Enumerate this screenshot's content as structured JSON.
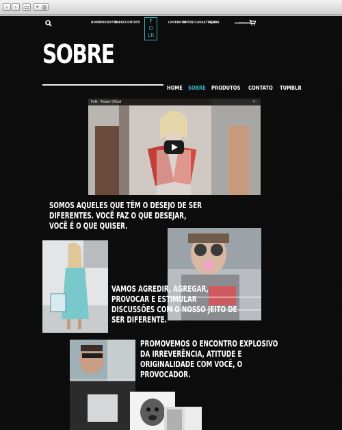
{
  "browser": {
    "back": "‹",
    "forward": "›",
    "reader": "▭",
    "add": "+",
    "globe": "◍"
  },
  "top_nav": {
    "left_links": [
      "HOME",
      "PRODUTOS",
      "SOBRE",
      "CONTATO"
    ],
    "right_links": [
      "LOOKBOOK",
      "ENTRE/CADASTRE-SE",
      "AJUDA"
    ],
    "cart_label": "CARRINHO"
  },
  "logo": {
    "letters": [
      "F",
      "O",
      "L",
      "K"
    ]
  },
  "page_title": "SOBRE",
  "secondary_nav": [
    {
      "label": "HOME",
      "active": false
    },
    {
      "label": "SOBRE",
      "active": true
    },
    {
      "label": "PRODUTOS",
      "active": false
    },
    {
      "label": "CONTATO",
      "active": false
    },
    {
      "label": "TUMBLR",
      "active": false
    }
  ],
  "video": {
    "title": "Folk - Teaser Oficial"
  },
  "copy_blocks": [
    [
      "SOMOS AQUELES QUE TÊM O DESEJO DE SER",
      "DIFERENTES. VOCÊ FAZ O QUE DESEJAR,",
      "VOCÊ É O QUE QUISER."
    ],
    [
      "VAMOS AGREDIR, AGREGAR,",
      "PROVOCAR E ESTIMULAR",
      "DISCUSSÕES COM O NOSSO JEITO DE",
      "SER DIFERENTE."
    ],
    [
      "PROMOVEMOS O ENCONTRO EXPLOSIVO",
      "DA IRREVERÊNCIA, ATITUDE E",
      "ORIGINALIDADE COM VOCÊ, O",
      "PROVOCADOR."
    ]
  ],
  "colors": {
    "accent": "#36b5c8",
    "background": "#0b0b0b",
    "text": "#ffffff"
  }
}
